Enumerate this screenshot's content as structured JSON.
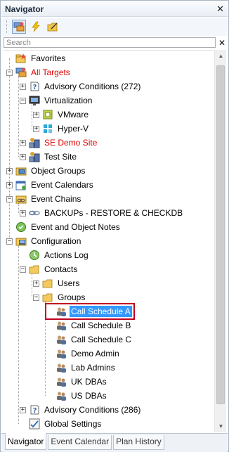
{
  "window": {
    "title": "Navigator",
    "close_glyph": "✕"
  },
  "toolbar": {
    "buttons": [
      {
        "icon": "targets-icon",
        "active": true
      },
      {
        "icon": "lightning-icon",
        "active": false
      },
      {
        "icon": "folder-edit-icon",
        "active": false
      }
    ]
  },
  "search": {
    "placeholder": "Search",
    "value": "",
    "clear_glyph": "✕"
  },
  "tree": {
    "nodes": [
      {
        "label": "Favorites",
        "icon": "favorites-icon",
        "depth": 0,
        "expander": "none"
      },
      {
        "label": "All Targets",
        "icon": "targets-icon",
        "depth": 0,
        "expander": "minus",
        "red": true
      },
      {
        "label": "Advisory Conditions (272)",
        "icon": "advisory-icon",
        "depth": 1,
        "expander": "plus"
      },
      {
        "label": "Virtualization",
        "icon": "monitor-icon",
        "depth": 1,
        "expander": "minus"
      },
      {
        "label": "VMware",
        "icon": "vmware-icon",
        "depth": 2,
        "expander": "plus"
      },
      {
        "label": "Hyper-V",
        "icon": "hyperv-icon",
        "depth": 2,
        "expander": "plus"
      },
      {
        "label": "SE Demo Site",
        "icon": "site-icon",
        "depth": 1,
        "expander": "plus",
        "red": true
      },
      {
        "label": "Test Site",
        "icon": "site-icon",
        "depth": 1,
        "expander": "plus"
      },
      {
        "label": "Object Groups",
        "icon": "object-groups-icon",
        "depth": 0,
        "expander": "plus"
      },
      {
        "label": "Event Calendars",
        "icon": "calendar-icon",
        "depth": 0,
        "expander": "plus"
      },
      {
        "label": "Event Chains",
        "icon": "chain-folder-icon",
        "depth": 0,
        "expander": "minus"
      },
      {
        "label": "BACKUPs - RESTORE & CHECKDB",
        "icon": "chain-icon",
        "depth": 1,
        "expander": "plus"
      },
      {
        "label": "Event and Object Notes",
        "icon": "notes-icon",
        "depth": 0,
        "expander": "none"
      },
      {
        "label": "Configuration",
        "icon": "config-icon",
        "depth": 0,
        "expander": "minus"
      },
      {
        "label": "Actions Log",
        "icon": "log-icon",
        "depth": 1,
        "expander": "none"
      },
      {
        "label": "Contacts",
        "icon": "folder-icon",
        "depth": 1,
        "expander": "minus"
      },
      {
        "label": "Users",
        "icon": "folder-icon",
        "depth": 2,
        "expander": "plus"
      },
      {
        "label": "Groups",
        "icon": "folder-icon",
        "depth": 2,
        "expander": "minus"
      },
      {
        "label": "Call Schedule A",
        "icon": "group-icon",
        "depth": 3,
        "expander": "none",
        "selected": true
      },
      {
        "label": "Call Schedule B",
        "icon": "group-icon",
        "depth": 3,
        "expander": "none"
      },
      {
        "label": "Call Schedule C",
        "icon": "group-icon",
        "depth": 3,
        "expander": "none"
      },
      {
        "label": "Demo Admin",
        "icon": "group-icon",
        "depth": 3,
        "expander": "none"
      },
      {
        "label": "Lab Admins",
        "icon": "group-icon",
        "depth": 3,
        "expander": "none"
      },
      {
        "label": "UK DBAs",
        "icon": "group-icon",
        "depth": 3,
        "expander": "none"
      },
      {
        "label": "US DBAs",
        "icon": "group-icon",
        "depth": 3,
        "expander": "none"
      },
      {
        "label": "Advisory Conditions (286)",
        "icon": "advisory-icon",
        "depth": 1,
        "expander": "plus"
      },
      {
        "label": "Global Settings",
        "icon": "settings-icon",
        "depth": 1,
        "expander": "none"
      }
    ]
  },
  "tabs": [
    {
      "label": "Navigator",
      "active": true
    },
    {
      "label": "Event Calendar",
      "active": false
    },
    {
      "label": "Plan History",
      "active": false
    }
  ],
  "colors": {
    "red_label": "#e00000",
    "selection": "#3399ff",
    "highlight_border": "#c0001f"
  }
}
